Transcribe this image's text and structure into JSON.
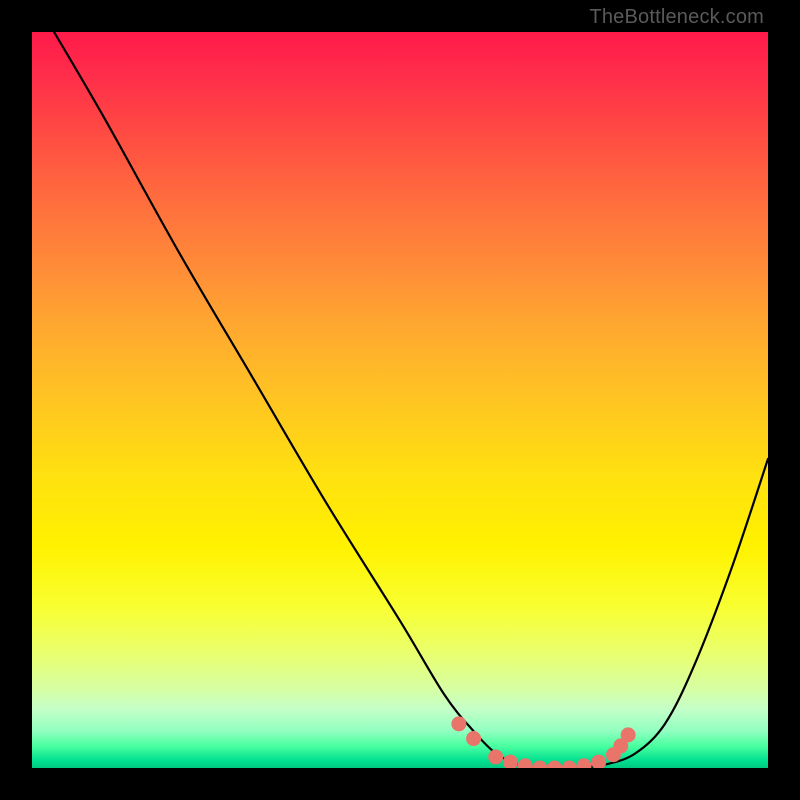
{
  "watermark": "TheBottleneck.com",
  "chart_data": {
    "type": "line",
    "title": "",
    "xlabel": "",
    "ylabel": "",
    "xlim": [
      0,
      100
    ],
    "ylim": [
      0,
      100
    ],
    "grid": false,
    "legend": false,
    "series": [
      {
        "name": "bottleneck-curve",
        "color": "#000000",
        "x": [
          3,
          10,
          20,
          30,
          40,
          50,
          56,
          60,
          63,
          66,
          70,
          74,
          78,
          82,
          86,
          90,
          95,
          100
        ],
        "y": [
          100,
          88,
          70,
          53,
          36,
          20,
          10,
          5,
          2,
          0.5,
          0,
          0,
          0.5,
          2,
          6,
          14,
          27,
          42
        ]
      },
      {
        "name": "optimal-zone-markers",
        "color": "#e8746a",
        "type": "scatter",
        "x": [
          58,
          60,
          63,
          65,
          67,
          69,
          71,
          73,
          75,
          77,
          79,
          80,
          81
        ],
        "y": [
          6,
          4,
          1.5,
          0.8,
          0.3,
          0,
          0,
          0,
          0.3,
          0.8,
          1.8,
          3,
          4.5
        ]
      }
    ],
    "gradient_meaning": "vertical color scale: red (top) = high bottleneck, green (bottom) = low bottleneck"
  }
}
